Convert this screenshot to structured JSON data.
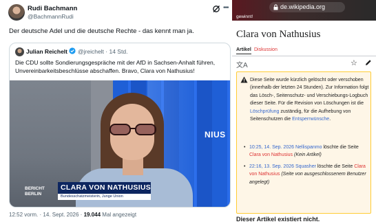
{
  "tweet": {
    "author_name": "Rudi Bachmann",
    "author_handle": "@BachmannRudi",
    "text": "Der deutsche Adel und die deutsche Rechte - das kennt man ja.",
    "more_icon": "more-dots-icon",
    "quote": {
      "author_name": "Julian Reichelt",
      "author_handle": "@jreichelt",
      "time_ago": "· 14 Std.",
      "text": "Die CDU sollte Sondierungsgespräche mit der AfD in Sachsen-Anhalt führen, Unvereinbarkeitsbeschlüsse abschaffen. Bravo, Clara von Nathusius!",
      "video": {
        "channel_logo": "NIUS",
        "show_name_line1": "BERICHT",
        "show_name_line2": "BERLIN",
        "lower_third_name": "CLARA VON NATHUSIUS",
        "lower_third_sub": "Bundesschatzmeisterin, Junge Union"
      }
    },
    "meta": {
      "time": "12:52 vorm.",
      "sep": "·",
      "date": "14. Sept. 2026",
      "sep2": "·",
      "views_count": "19.044",
      "views_label": "Mal angezeigt"
    }
  },
  "wiki": {
    "url": "de.wikipedia.org",
    "banner_text": "gewinnt!",
    "title": "Clara von Nathusius",
    "tab_article": "Artikel",
    "tab_discussion": "Diskussion",
    "notice": {
      "intro": "Diese Seite wurde kürzlich gelöscht oder verschoben (innerhalb der letzten 24 Stunden). Zur Information folgt das Lösch-, Seitenschutz- und Verschiebungs-Logbuch dieser Seite. Für die Revision von Löschungen ist die ",
      "link1": "Löschprüfung",
      "mid": " zuständig, für die Aufhebung von Seitenschutzen die ",
      "link2": "Entsperrwünsche",
      "end": ".",
      "entries": [
        {
          "time": "10:25, 14. Sep. 2026",
          "user": "Nellispanmo",
          "action": "löschte die Seite",
          "page": "Clara von Nathusius",
          "reason": "(Kein Artikel)"
        },
        {
          "time": "22:16, 13. Sep. 2026",
          "user": "Squasher",
          "action": "löschte die Seite",
          "page": "Clara von Nathusius",
          "reason": "(Seite von ausgeschlossenem Benutzer angelegt)"
        }
      ]
    },
    "bottom_text": "Dieser Artikel existiert nicht."
  }
}
